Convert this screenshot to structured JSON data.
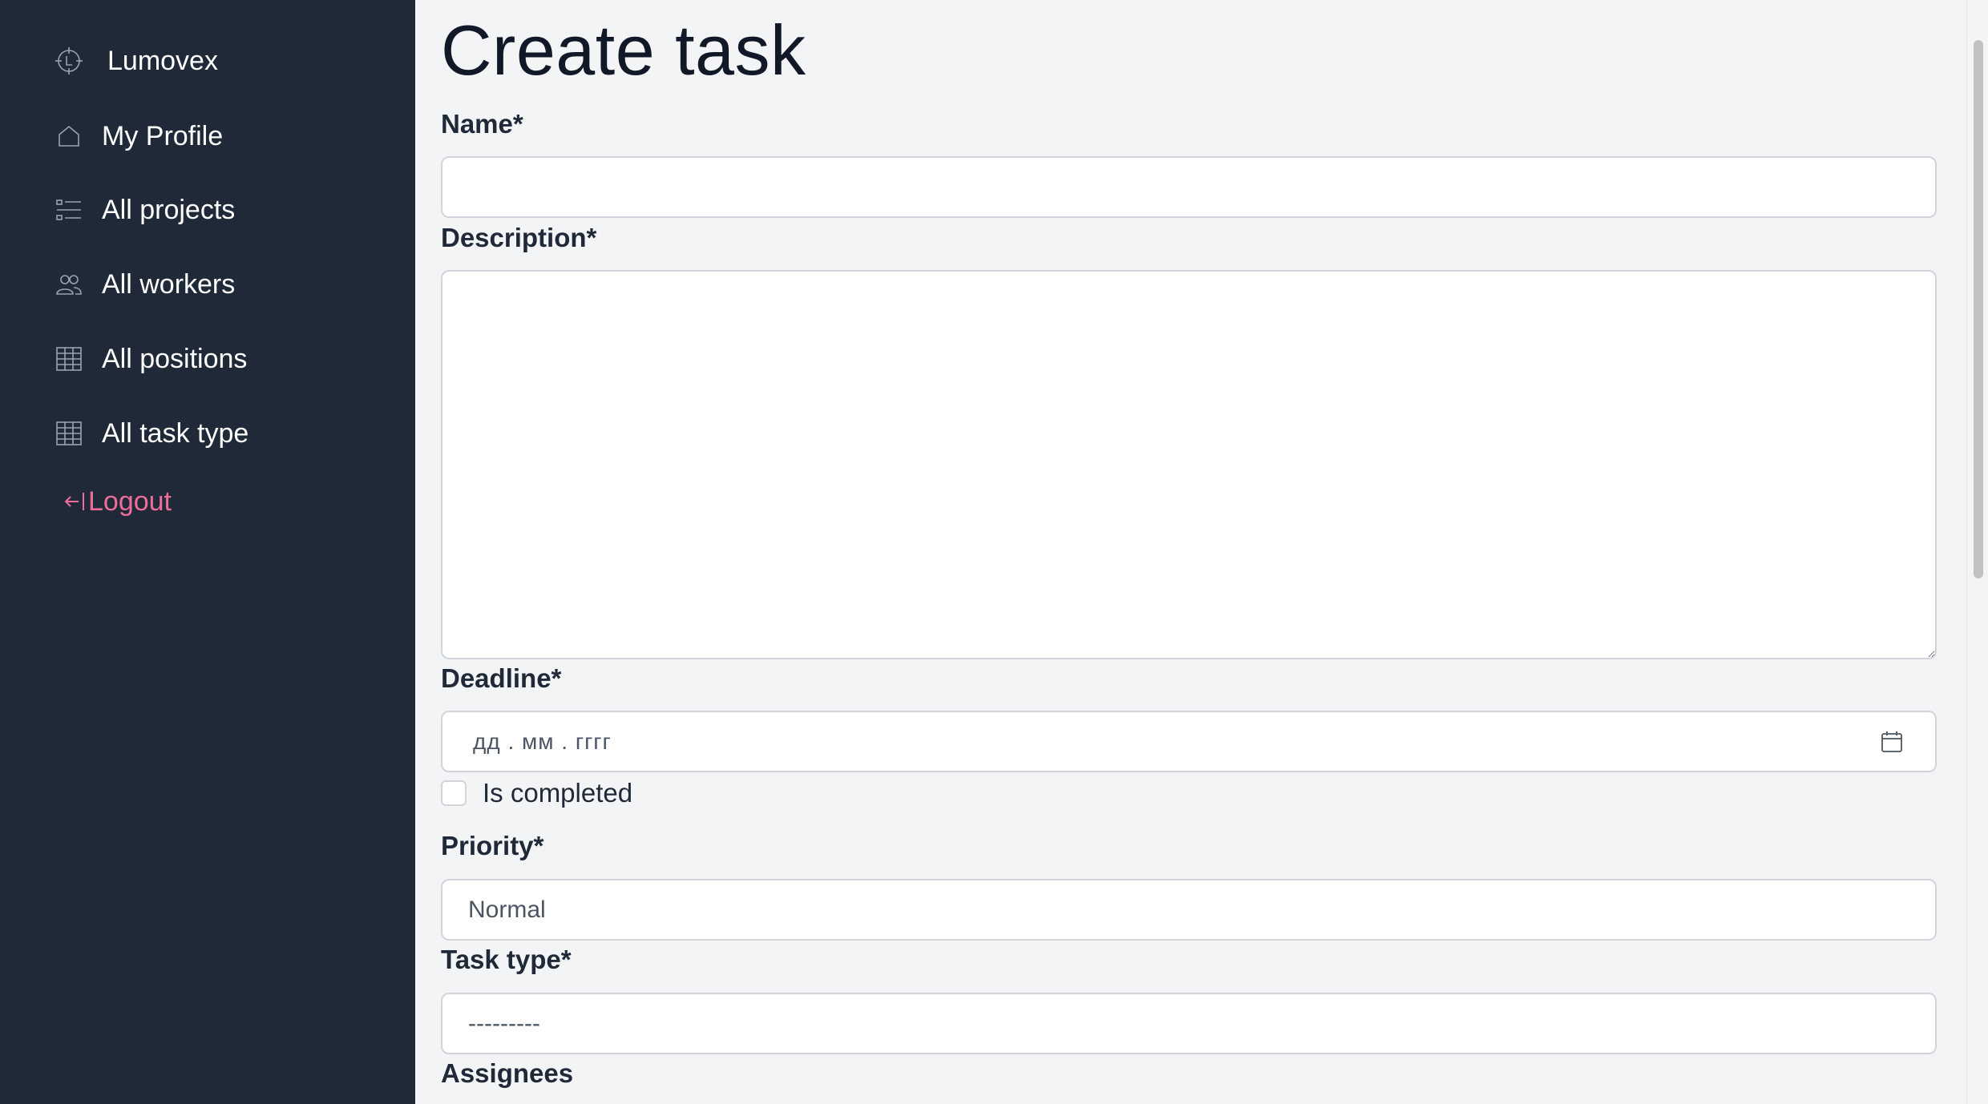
{
  "sidebar": {
    "brand": "Lumovex",
    "items": [
      {
        "label": "My Profile",
        "icon": "home-icon"
      },
      {
        "label": "All projects",
        "icon": "list-icon"
      },
      {
        "label": "All workers",
        "icon": "users-icon"
      },
      {
        "label": "All positions",
        "icon": "table-icon"
      },
      {
        "label": "All task type",
        "icon": "table-icon"
      }
    ],
    "logout": "Logout"
  },
  "form": {
    "title": "Create task",
    "name_label": "Name*",
    "name_value": "",
    "description_label": "Description*",
    "description_value": "",
    "deadline_label": "Deadline*",
    "deadline_placeholder": "дд . мм . гггг",
    "completed_label": "Is completed",
    "priority_label": "Priority*",
    "priority_value": "Normal",
    "task_type_label": "Task type*",
    "task_type_value": "---------",
    "assignees_label": "Assignees"
  },
  "colors": {
    "sidebar_bg": "#1f2937",
    "main_bg": "#f3f4f6",
    "logout": "#ec6d99"
  }
}
